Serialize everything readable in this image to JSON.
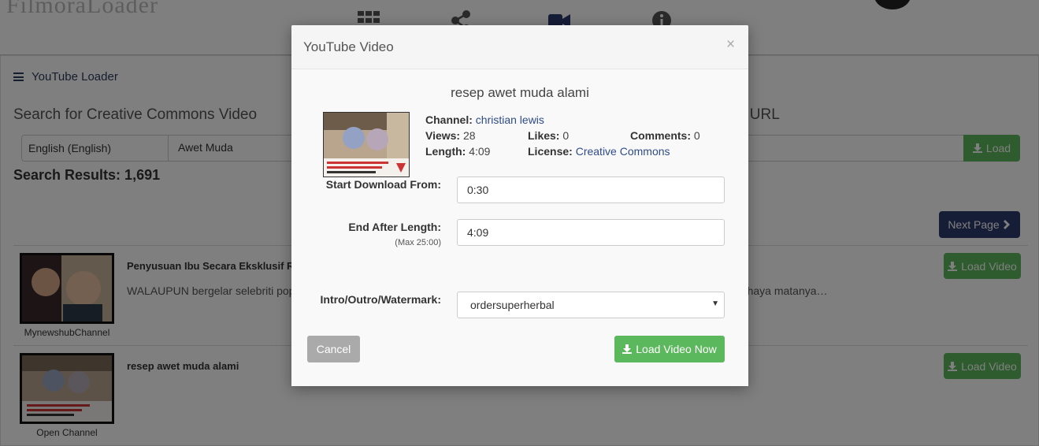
{
  "background": {
    "panel_title": "YouTube Loader",
    "search_heading": "Search for Creative Commons Video",
    "url_heading": "Download Video By URL",
    "language_value": "English (English)",
    "search_value": "Awet Muda",
    "load_button": "Load",
    "results_label": "Search Results: 1,691",
    "next_page_button": "Next Page",
    "rows": [
      {
        "title": "Penyusuan Ibu Secara Eksklusif Ranu",
        "description": "WALAUPUN bergelar selebriti popular",
        "description_tail": "bahaya matanya…",
        "channel": "MynewshubChannel",
        "button": "Load Video"
      },
      {
        "title": "resep awet muda alami",
        "channel": "Open Channel",
        "button": "Load Video"
      }
    ]
  },
  "modal": {
    "title": "YouTube Video",
    "close_symbol": "×",
    "video_title": "resep awet muda alami",
    "channel_label": "Channel:",
    "channel_value": "christian lewis",
    "views_label": "Views:",
    "views_value": "28",
    "likes_label": "Likes:",
    "likes_value": "0",
    "comments_label": "Comments:",
    "comments_value": "0",
    "length_label": "Length:",
    "length_value": "4:09",
    "license_label": "License:",
    "license_value": "Creative Commons",
    "start_label": "Start Download From:",
    "start_value": "0:30",
    "end_label": "End After Length:",
    "end_sub": "(Max 25:00)",
    "end_value": "4:09",
    "intro_label": "Intro/Outro/Watermark:",
    "intro_value": "ordersuperherbal",
    "cancel_button": "Cancel",
    "load_now_button": "Load Video Now"
  },
  "colors": {
    "green": "#5cb85c",
    "navy": "#2d3b6e",
    "link": "#2e4c8a"
  }
}
